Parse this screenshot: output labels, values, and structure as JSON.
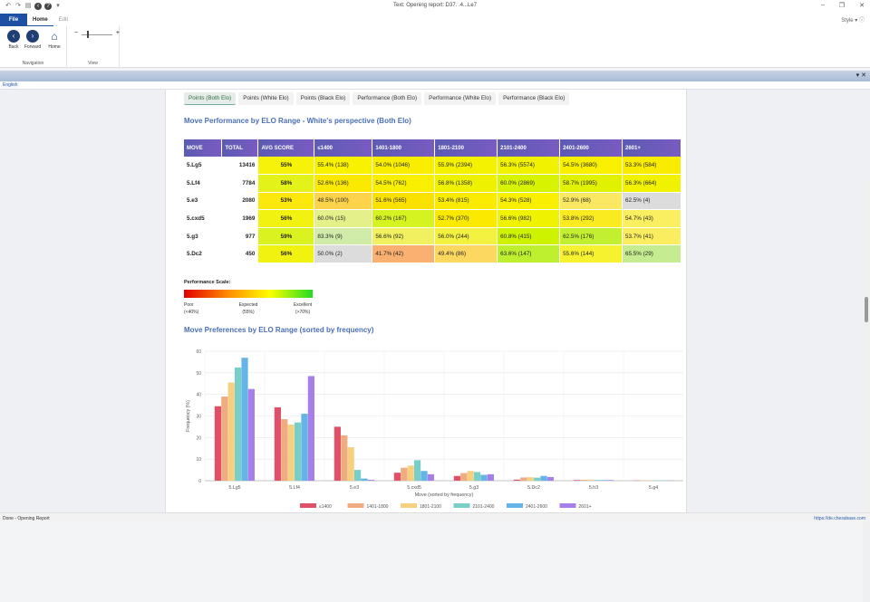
{
  "window": {
    "title": "Text: Opening report: D37. .4...Le7",
    "style_label": "Style"
  },
  "ribbon": {
    "tabs": [
      "File",
      "Home",
      "Edit"
    ],
    "groups": {
      "navigation": {
        "caption": "Navigation",
        "back": "Back",
        "forward": "Forward",
        "home": "Home"
      },
      "view": {
        "caption": "View",
        "minus": "−",
        "plus": "+"
      }
    }
  },
  "lang_tab": "English",
  "status": {
    "left": "Done - Opening Report",
    "right": "https://de.chessbase.com"
  },
  "report": {
    "tabs": [
      "Points (Both Elo)",
      "Points (White Elo)",
      "Points (Black Elo)",
      "Performance (Both Elo)",
      "Performance (White Elo)",
      "Performance (Black Elo)"
    ],
    "active_tab": 0,
    "table_title": "Move Performance by ELO Range - White's perspective (Both Elo)",
    "columns": [
      "MOVE",
      "TOTAL",
      "AVG SCORE",
      "≤1400",
      "1401-1800",
      "1801-2100",
      "2101-2400",
      "2401-2600",
      "2601+"
    ],
    "rows": [
      {
        "move": "5.Lg5",
        "total": "13416",
        "avg": "55%",
        "avg_color": "#f6f20a",
        "cells": [
          {
            "t": "55.4% (138)",
            "c": "#f8f100"
          },
          {
            "t": "54.0% (1046)",
            "c": "#f9ee00"
          },
          {
            "t": "55.9% (2394)",
            "c": "#f5f200"
          },
          {
            "t": "56.3% (5574)",
            "c": "#f1f200"
          },
          {
            "t": "54.5% (3680)",
            "c": "#f9f000"
          },
          {
            "t": "53.3% (584)",
            "c": "#faec00"
          }
        ]
      },
      {
        "move": "5.Lf4",
        "total": "7784",
        "avg": "58%",
        "avg_color": "#e3f218",
        "cells": [
          {
            "t": "52.6% (136)",
            "c": "#fbe900"
          },
          {
            "t": "54.5% (762)",
            "c": "#f9ef00"
          },
          {
            "t": "56.8% (1358)",
            "c": "#eef200"
          },
          {
            "t": "60.0% (2869)",
            "c": "#d7f300"
          },
          {
            "t": "58.7% (1995)",
            "c": "#e0f200"
          },
          {
            "t": "56.3% (664)",
            "c": "#f1f200"
          }
        ]
      },
      {
        "move": "5.e3",
        "total": "2080",
        "avg": "53%",
        "avg_color": "#fce80c",
        "cells": [
          {
            "t": "48.5% (100)",
            "c": "#fcd34a"
          },
          {
            "t": "51.6% (565)",
            "c": "#fbe100"
          },
          {
            "t": "53.4% (815)",
            "c": "#faeb00"
          },
          {
            "t": "54.3% (528)",
            "c": "#f9ef00"
          },
          {
            "t": "52.9% (68)",
            "c": "#fae862"
          },
          {
            "t": "62.5% (4)",
            "c": "#dcdcdc"
          }
        ]
      },
      {
        "move": "5.cxd5",
        "total": "1969",
        "avg": "56%",
        "avg_color": "#f1f20f",
        "cells": [
          {
            "t": "60.0% (15)",
            "c": "#e4f08a"
          },
          {
            "t": "60.2% (167)",
            "c": "#d5f320"
          },
          {
            "t": "52.7% (370)",
            "c": "#fbe900"
          },
          {
            "t": "56.6% (982)",
            "c": "#eff200"
          },
          {
            "t": "53.8% (292)",
            "c": "#faea20"
          },
          {
            "t": "54.7% (43)",
            "c": "#faef60"
          }
        ]
      },
      {
        "move": "5.g3",
        "total": "977",
        "avg": "59%",
        "avg_color": "#daf220",
        "cells": [
          {
            "t": "83.3% (9)",
            "c": "#d0eca8"
          },
          {
            "t": "56.6% (92)",
            "c": "#f0f060"
          },
          {
            "t": "56.0% (244)",
            "c": "#f3f240"
          },
          {
            "t": "60.8% (415)",
            "c": "#cef300"
          },
          {
            "t": "62.5% (176)",
            "c": "#c2f030"
          },
          {
            "t": "53.7% (41)",
            "c": "#faee60"
          }
        ]
      },
      {
        "move": "5.Dc2",
        "total": "450",
        "avg": "56%",
        "avg_color": "#f1f20f",
        "cells": [
          {
            "t": "50.0% (2)",
            "c": "#dcdcdc"
          },
          {
            "t": "41.7% (42)",
            "c": "#f9b070"
          },
          {
            "t": "49.4% (86)",
            "c": "#fcd860"
          },
          {
            "t": "63.6% (147)",
            "c": "#bff030"
          },
          {
            "t": "55.6% (144)",
            "c": "#f6f230"
          },
          {
            "t": "65.5% (29)",
            "c": "#c5ec90"
          }
        ]
      }
    ],
    "scale": {
      "title": "Performance Scale:",
      "poor": "Poor",
      "poor_sub": "(<40%)",
      "expected": "Expected",
      "expected_sub": "(55%)",
      "excellent": "Excellent",
      "excellent_sub": "(>70%)"
    },
    "chart_title": "Move Preferences by ELO Range (sorted by frequency)"
  },
  "chart_data": {
    "type": "bar",
    "title": "Move Preferences by ELO Range (sorted by frequency)",
    "xlabel": "Move (sorted by frequency)",
    "ylabel": "Frequency (%)",
    "ylim": [
      0,
      60
    ],
    "yticks": [
      0,
      10,
      20,
      30,
      40,
      50,
      60
    ],
    "categories": [
      "5.Lg5",
      "5.Lf4",
      "5.e3",
      "5.cxd5",
      "5.g3",
      "5.Dc2",
      "5.h3",
      "5.g4"
    ],
    "series": [
      {
        "name": "≤1400",
        "color": "#e05068",
        "values": [
          34.5,
          34.0,
          25.0,
          3.7,
          2.2,
          0.5,
          0.3,
          0.1
        ]
      },
      {
        "name": "1401-1800",
        "color": "#f0ac80",
        "values": [
          39.0,
          28.5,
          21.0,
          6.0,
          3.5,
          1.5,
          0.4,
          0.1
        ]
      },
      {
        "name": "1801-2100",
        "color": "#f6d080",
        "values": [
          45.5,
          26.0,
          15.5,
          7.0,
          4.5,
          1.6,
          0.5,
          0.1
        ]
      },
      {
        "name": "2101-2400",
        "color": "#78cfc8",
        "values": [
          52.5,
          27.0,
          5.0,
          9.5,
          4.0,
          1.4,
          0.3,
          0.1
        ]
      },
      {
        "name": "2401-2600",
        "color": "#64b4e8",
        "values": [
          57.0,
          31.0,
          1.0,
          4.5,
          2.7,
          2.2,
          0.3,
          0.1
        ]
      },
      {
        "name": "2601+",
        "color": "#a680e8",
        "values": [
          42.5,
          48.5,
          0.4,
          3.0,
          3.0,
          1.7,
          0.3,
          0.1
        ]
      }
    ],
    "legend": "bottom"
  }
}
